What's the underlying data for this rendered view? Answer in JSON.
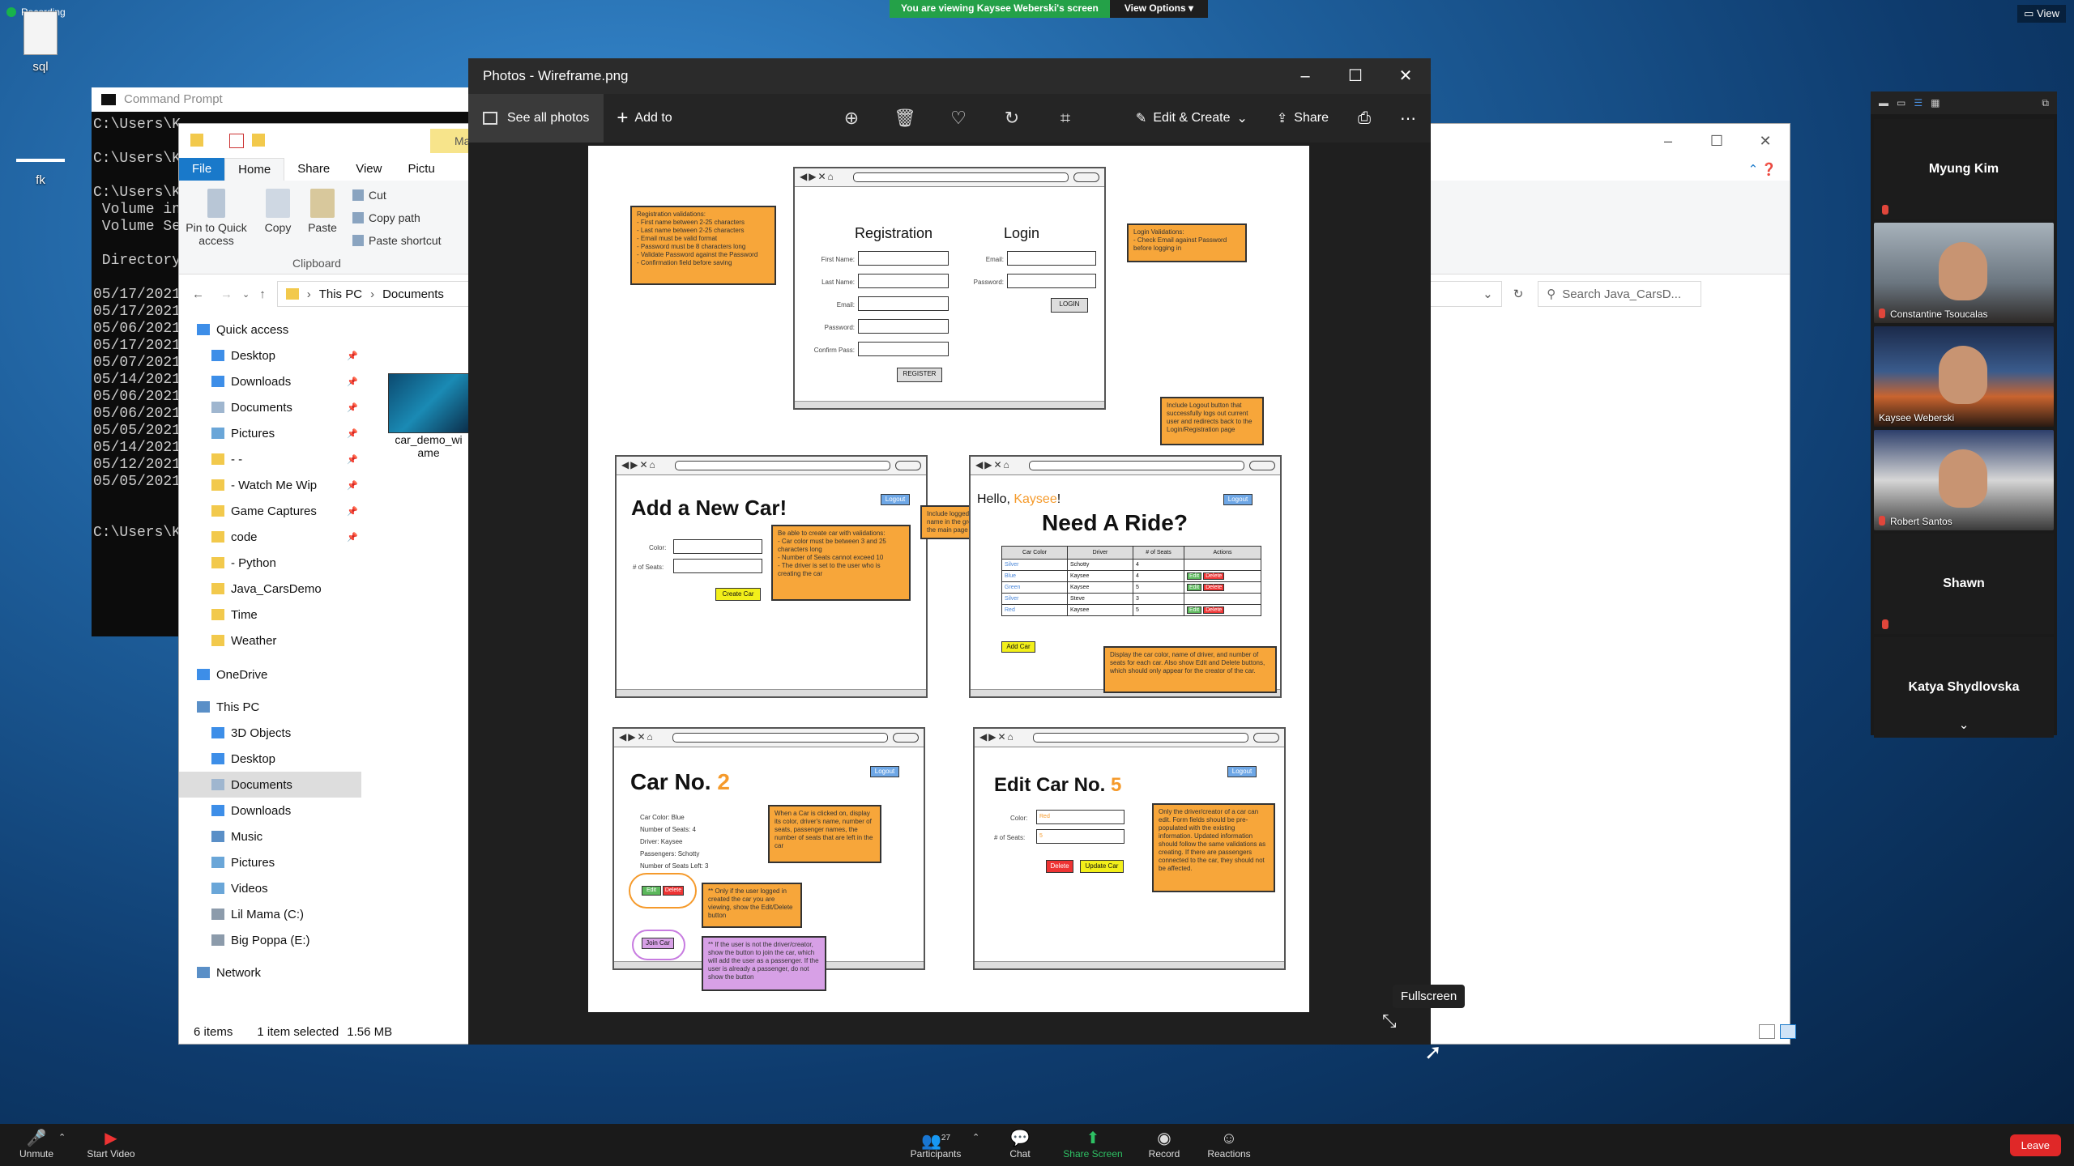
{
  "desktop": {
    "recording_label": "Recording",
    "icons": [
      {
        "label": "sql"
      },
      {
        "label": "fk"
      }
    ]
  },
  "zoom_banner": {
    "viewing_text": "You are viewing Kaysee Weberski's screen",
    "view_options": "View Options",
    "view_button": "View"
  },
  "cmd": {
    "title": "Command Prompt",
    "lines": [
      "C:\\Users\\K",
      "",
      "C:\\Users\\K",
      "",
      "C:\\Users\\K",
      " Volume in",
      " Volume Se",
      "",
      " Directory",
      "",
      "05/17/2021",
      "05/17/2021",
      "05/06/2021",
      "05/17/2021",
      "05/07/2021",
      "05/14/2021",
      "05/06/2021",
      "05/06/2021",
      "05/05/2021",
      "05/14/2021",
      "05/12/2021",
      "05/05/2021",
      "",
      "",
      "C:\\Users\\K"
    ]
  },
  "explorer": {
    "title_tab": "Ma",
    "ribbon_tabs": [
      "File",
      "Home",
      "Share",
      "View",
      "Pictu"
    ],
    "ribbon": {
      "pin": "Pin to Quick access",
      "copy": "Copy",
      "paste": "Paste",
      "cut": "Cut",
      "copy_path": "Copy path",
      "paste_shortcut": "Paste shortcut",
      "group": "Clipboard"
    },
    "breadcrumb": [
      "This PC",
      "Documents"
    ],
    "search_placeholder": "Search Java_CarsD...",
    "nav": [
      {
        "label": "Quick access",
        "type": "star"
      },
      {
        "label": "Desktop",
        "type": "blue",
        "pin": true
      },
      {
        "label": "Downloads",
        "type": "down",
        "pin": true
      },
      {
        "label": "Documents",
        "type": "doc",
        "pin": true
      },
      {
        "label": "Pictures",
        "type": "pic",
        "pin": true
      },
      {
        "label": "- -",
        "type": "folder",
        "pin": true
      },
      {
        "label": "- Watch Me Wip",
        "type": "folder",
        "pin": true
      },
      {
        "label": "Game Captures",
        "type": "folder",
        "pin": true
      },
      {
        "label": "code",
        "type": "folder",
        "pin": true
      },
      {
        "label": "- Python",
        "type": "folder"
      },
      {
        "label": "Java_CarsDemo",
        "type": "folder"
      },
      {
        "label": "Time",
        "type": "folder"
      },
      {
        "label": "Weather",
        "type": "folder"
      },
      {
        "label": "OneDrive",
        "type": "cloud"
      },
      {
        "label": "This PC",
        "type": "pc"
      },
      {
        "label": "3D Objects",
        "type": "blue"
      },
      {
        "label": "Desktop",
        "type": "blue"
      },
      {
        "label": "Documents",
        "type": "doc",
        "selected": true
      },
      {
        "label": "Downloads",
        "type": "down"
      },
      {
        "label": "Music",
        "type": "music"
      },
      {
        "label": "Pictures",
        "type": "pic"
      },
      {
        "label": "Videos",
        "type": "pic"
      },
      {
        "label": "Lil Mama (C:)",
        "type": "drive"
      },
      {
        "label": "Big Poppa (E:)",
        "type": "drive"
      },
      {
        "label": "Network",
        "type": "net"
      }
    ],
    "file": {
      "name": "car_demo_wi ame"
    },
    "status": {
      "items": "6 items",
      "selected": "1 item selected",
      "size": "1.56 MB"
    }
  },
  "photos": {
    "title": "Photos - Wireframe.png",
    "see_all": "See all photos",
    "add_to": "Add to",
    "edit_create": "Edit & Create",
    "share": "Share",
    "tooltip": "Fullscreen"
  },
  "wireframe": {
    "reg": {
      "registration": "Registration",
      "login": "Login",
      "reg_fields": [
        "First Name:",
        "Last Name:",
        "Email:",
        "Password:",
        "Confirm Pass:"
      ],
      "login_fields": [
        "Email:",
        "Password:"
      ],
      "login_btn": "LOGIN",
      "register_btn": "REGISTER",
      "note_reg": "Registration validations:\n- First name between 2-25 characters\n- Last name between 2-25 characters\n- Email must be valid format\n- Password must be 8 characters long\n- Validate Password against the Password\n- Confirmation field before saving",
      "note_login": "Login Validations:\n- Check Email against Password before logging in",
      "note_logout": "Include Logout button that successfully logs out current user and redirects back to the Login/Registration page"
    },
    "add": {
      "heading": "Add a New Car!",
      "color": "Color:",
      "seats": "# of Seats:",
      "create": "Create Car",
      "logout": "Logout",
      "note": "Be able to create car with validations:\n- Car color must be between 3 and 25 characters long\n- Number of Seats cannot exceed 10\n- The driver is set to the user who is creating the car",
      "note_greet": "Include logged in user's name in the greeting for the main page"
    },
    "ride": {
      "hello": "Hello,",
      "name": "Kaysee",
      "exclaim": "!",
      "heading": "Need A Ride?",
      "logout": "Logout",
      "columns": [
        "Car Color",
        "Driver",
        "# of Seats",
        "Actions"
      ],
      "rows": [
        [
          "Silver",
          "Schotty",
          "4",
          ""
        ],
        [
          "Blue",
          "Kaysee",
          "4",
          "edit"
        ],
        [
          "Green",
          "Kaysee",
          "5",
          "edit"
        ],
        [
          "Silver",
          "Steve",
          "3",
          ""
        ],
        [
          "Red",
          "Kaysee",
          "5",
          "edit"
        ]
      ],
      "edit": "Edit",
      "delete": "Delete",
      "add_car": "Add Car",
      "note": "Display the car color, name of driver, and number of seats for each car. Also show Edit and Delete buttons, which should only appear for the creator of the car."
    },
    "car": {
      "heading": "Car No.",
      "num": "2",
      "logout": "Logout",
      "details": [
        "Car Color: Blue",
        "Number of Seats: 4",
        "Driver: Kaysee",
        "Passengers: Schotty",
        "Number of Seats Left: 3"
      ],
      "edit": "Edit",
      "delete": "Delete",
      "join": "Join Car",
      "note1": "When a Car is clicked on, display its color, driver's name, number of seats, passenger names, the number of seats that are left in the car",
      "note2": "** Only if the user logged in created the car you are viewing, show the Edit/Delete button",
      "note3": "** If the user is not the driver/creator, show the button to join the car, which will add the user as a passenger. If the user is already a passenger, do not show the button"
    },
    "edit": {
      "heading": "Edit Car No.",
      "num": "5",
      "logout": "Logout",
      "color": "Color:",
      "seats": "# of Seats:",
      "color_val": "Red",
      "seats_val": "5",
      "delete": "Delete",
      "update": "Update Car",
      "note": "Only the driver/creator of a car can edit. Form fields should be pre-populated with the existing information. Updated information should follow the same validations as creating. If there are passengers connected to the car, they should not be affected."
    }
  },
  "zoom": {
    "participants": [
      {
        "name": "Myung Kim",
        "video": false,
        "muted": true
      },
      {
        "name": "Constantine Tsoucalas",
        "video": true,
        "muted": true
      },
      {
        "name": "Kaysee Weberski",
        "video": true,
        "muted": false
      },
      {
        "name": "Robert Santos",
        "video": true,
        "muted": true
      },
      {
        "name": "Shawn",
        "video": false,
        "muted": true
      },
      {
        "name": "Katya Shydlovska",
        "video": false,
        "muted": false
      }
    ],
    "bar": {
      "unmute": "Unmute",
      "start_video": "Start Video",
      "participants": "Participants",
      "participants_count": "27",
      "chat": "Chat",
      "share_screen": "Share Screen",
      "record": "Record",
      "reactions": "Reactions",
      "leave": "Leave"
    }
  }
}
